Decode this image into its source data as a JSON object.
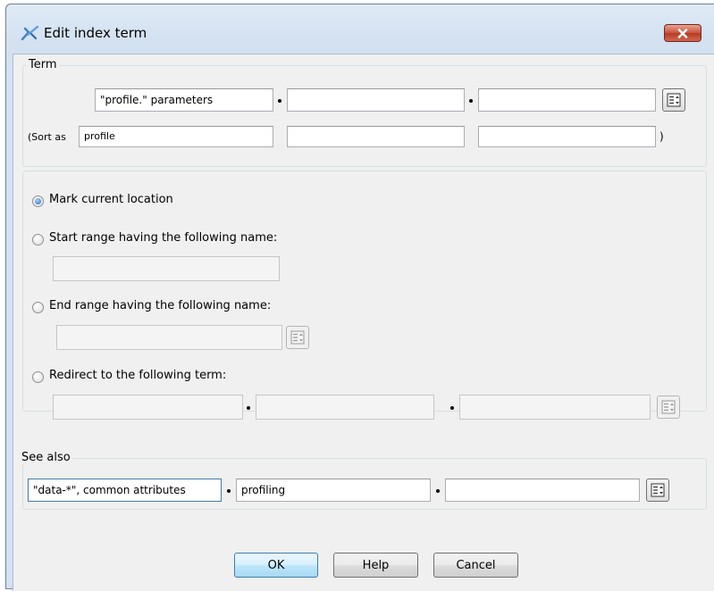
{
  "window": {
    "title": "Edit index term",
    "icon": "index-term-icon",
    "close_icon": "close-icon"
  },
  "term": {
    "legend": "Term",
    "fields": [
      "\"profile.\" parameters",
      "",
      ""
    ],
    "sort_prefix": "(Sort as",
    "sort_fields": [
      "profile",
      "",
      ""
    ],
    "sort_suffix": ")"
  },
  "location": {
    "mark_current": "Mark current location",
    "start_range": "Start range having the following name:",
    "start_range_value": "",
    "end_range": "End range having the following name:",
    "end_range_value": "",
    "redirect": "Redirect to the following term:",
    "redirect_fields": [
      "",
      "",
      ""
    ],
    "selected": "mark_current"
  },
  "see_also": {
    "legend": "See also",
    "fields": [
      "\"data-*\", common attributes",
      "profiling",
      ""
    ]
  },
  "buttons": {
    "ok": "OK",
    "help": "Help",
    "cancel": "Cancel"
  }
}
